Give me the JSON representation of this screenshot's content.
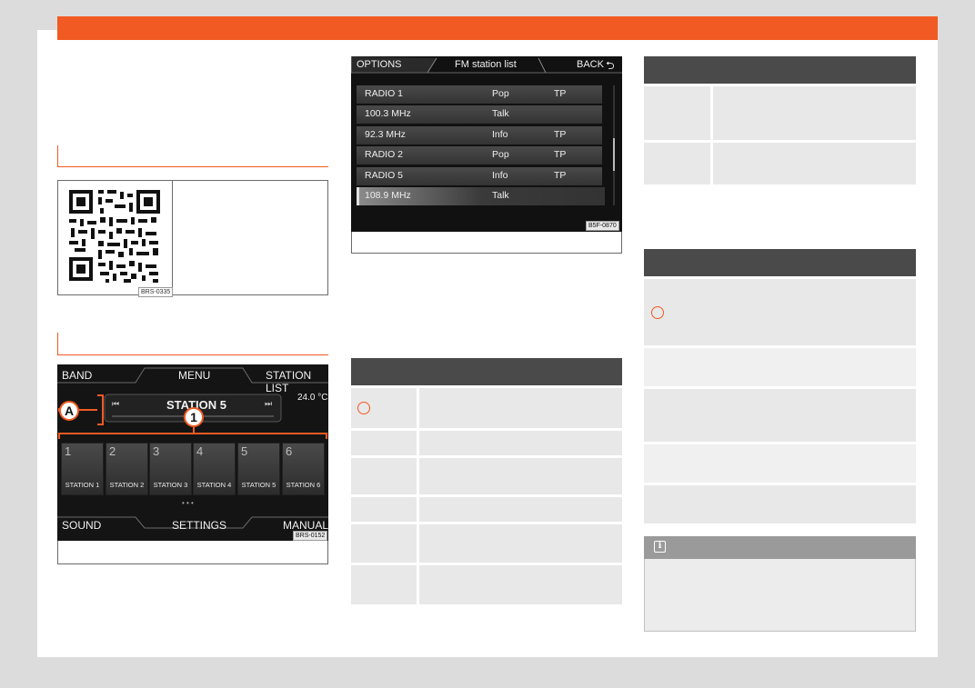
{
  "figure_qr": {
    "code": "BRS-0335"
  },
  "figure_radio": {
    "band_label": "BAND",
    "menu_label": "MENU",
    "station_list_label": "STATION LIST",
    "station_name": "STATION 5",
    "temperature": "24.0 °C",
    "callout_a": "A",
    "callout_1": "1",
    "presets": [
      {
        "number": "1",
        "label": "STATION 1"
      },
      {
        "number": "2",
        "label": "STATION 2"
      },
      {
        "number": "3",
        "label": "STATION 3"
      },
      {
        "number": "4",
        "label": "STATION 4"
      },
      {
        "number": "5",
        "label": "STATION 5"
      },
      {
        "number": "6",
        "label": "STATION 6"
      }
    ],
    "sound_label": "SOUND",
    "settings_label": "SETTINGS",
    "manual_label": "MANUAL",
    "code": "BRS-0152"
  },
  "figure_station_list": {
    "options_label": "OPTIONS",
    "title": "FM station list",
    "back_label": "BACK",
    "rows": [
      {
        "name": "RADIO 1",
        "genre": "Pop",
        "tp": "TP"
      },
      {
        "name": "100.3 MHz",
        "genre": "Talk",
        "tp": ""
      },
      {
        "name": "92.3 MHz",
        "genre": "Info",
        "tp": "TP"
      },
      {
        "name": "RADIO 2",
        "genre": "Pop",
        "tp": "TP"
      },
      {
        "name": "RADIO 5",
        "genre": "Info",
        "tp": "TP"
      },
      {
        "name": "108.9 MHz",
        "genre": "Talk",
        "tp": ""
      }
    ],
    "code": "B5F-0870"
  },
  "colors": {
    "accent": "#f15a22",
    "table_header": "#4a4a4a",
    "row_bg": "#e8e8e8"
  }
}
